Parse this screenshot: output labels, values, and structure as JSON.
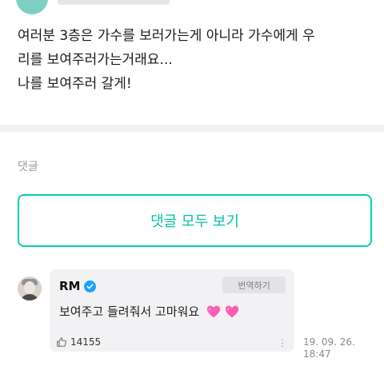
{
  "post": {
    "body": "여러분 3층은 가수를 보러가는게 아니라 가수에게 우\n리를 보여주러가는거래요...\n나를 보여주러 갈게!"
  },
  "comments_section": {
    "label": "댓글",
    "view_all_label": "댓글 모두 보기"
  },
  "comment": {
    "author": "RM",
    "verified": true,
    "translate_label": "번역하기",
    "text": "보여주고 들려줘서 고마워요",
    "emoji": [
      "sparkling-heart",
      "sparkling-heart"
    ],
    "likes": "14155",
    "date": "19. 09. 26.\n18:47"
  },
  "colors": {
    "accent": "#00d1b2",
    "verified": "#1fa0ff",
    "heart": "#ff5cb4"
  }
}
